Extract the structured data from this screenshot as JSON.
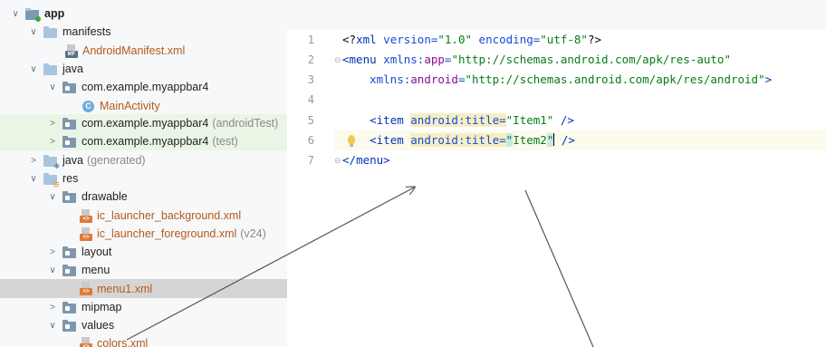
{
  "tree": {
    "items": [
      {
        "label": "app",
        "dim": "",
        "icon": "app-module-icon"
      },
      {
        "label": "manifests",
        "dim": "",
        "icon": "folder-icon"
      },
      {
        "label": "AndroidManifest.xml",
        "dim": "",
        "icon": "manifest-file-icon"
      },
      {
        "label": "java",
        "dim": "",
        "icon": "folder-icon"
      },
      {
        "label": "com.example.myappbar4",
        "dim": "",
        "icon": "package-icon"
      },
      {
        "label": "MainActivity",
        "dim": "",
        "icon": "class-icon"
      },
      {
        "label": "com.example.myappbar4",
        "dim": "(androidTest)",
        "icon": "package-icon"
      },
      {
        "label": "com.example.myappbar4",
        "dim": "(test)",
        "icon": "package-icon"
      },
      {
        "label": "java",
        "dim": "(generated)",
        "icon": "generated-folder-icon"
      },
      {
        "label": "res",
        "dim": "",
        "icon": "resources-folder-icon"
      },
      {
        "label": "drawable",
        "dim": "",
        "icon": "folder-icon"
      },
      {
        "label": "ic_launcher_background.xml",
        "dim": "",
        "icon": "xml-file-icon"
      },
      {
        "label": "ic_launcher_foreground.xml",
        "dim": "(v24)",
        "icon": "xml-file-icon"
      },
      {
        "label": "layout",
        "dim": "",
        "icon": "folder-icon"
      },
      {
        "label": "menu",
        "dim": "",
        "icon": "folder-icon"
      },
      {
        "label": "menu1.xml",
        "dim": "",
        "icon": "xml-file-icon"
      },
      {
        "label": "mipmap",
        "dim": "",
        "icon": "folder-icon"
      },
      {
        "label": "values",
        "dim": "",
        "icon": "folder-icon"
      },
      {
        "label": "colors.xml",
        "dim": "",
        "icon": "xml-file-icon"
      }
    ],
    "expanded_glyph": "∨",
    "collapsed_glyph": ">",
    "class_glyph": "C",
    "manifest_badge": "MF",
    "xml_badge": "<>"
  },
  "editor": {
    "line_numbers": [
      "1",
      "2",
      "3",
      "4",
      "5",
      "6",
      "7"
    ],
    "code": {
      "l1": {
        "a": "<?",
        "b": "xml",
        "c": " version=",
        "d": "\"1.0\"",
        "e": " encoding=",
        "f": "\"utf-8\"",
        "g": "?>"
      },
      "l2": {
        "a": "<",
        "b": "menu",
        "c": " xmlns:",
        "d": "app",
        "e": "=",
        "f": "\"http://schemas.android.com/apk/res-auto\""
      },
      "l3": {
        "a": "    xmlns:",
        "b": "android",
        "c": "=",
        "d": "\"http://schemas.android.com/apk/res/android\"",
        "e": ">"
      },
      "l5": {
        "a": "    <",
        "b": "item",
        "c": " ",
        "d": "android",
        "e": ":title=",
        "f": "\"Item1\"",
        "g": " />"
      },
      "l6": {
        "a": "    <",
        "b": "item",
        "c": " ",
        "d": "android",
        "e": ":title=",
        "f": "\"",
        "g": "Item2",
        "h": "\"",
        "i": " />"
      },
      "l7": {
        "a": "</",
        "b": "menu",
        "c": ">"
      }
    },
    "current_line": 6
  },
  "colors": {
    "tree_bg": "#f7f8fa",
    "selection": "#d5d5d5",
    "test_bg": "#eaf5e6",
    "xml_tag": "#0033b3",
    "xml_value": "#067d17",
    "namespace": "#871094"
  }
}
